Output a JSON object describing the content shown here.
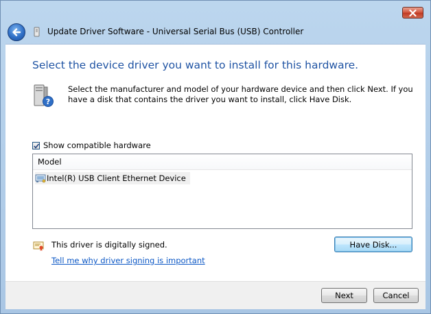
{
  "window": {
    "title": "Update Driver Software - Universal Serial Bus (USB) Controller"
  },
  "content": {
    "heading": "Select the device driver you want to install for this hardware.",
    "instructions": "Select the manufacturer and model of your hardware device and then click Next. If you have a disk that contains the driver you want to install, click Have Disk.",
    "show_compatible": {
      "label": "Show compatible hardware",
      "checked": true
    },
    "model_list": {
      "column_header": "Model",
      "items": [
        {
          "label": "Intel(R) USB Client Ethernet Device",
          "icon": "network-adapter-icon"
        }
      ]
    },
    "signed_text": "This driver is digitally signed.",
    "signing_link": "Tell me why driver signing is important",
    "have_disk_label": "Have Disk..."
  },
  "footer": {
    "next_label": "Next",
    "cancel_label": "Cancel"
  },
  "colors": {
    "heading": "#1f53a3",
    "link": "#0b57c5",
    "frame": "#bcd6ee"
  }
}
